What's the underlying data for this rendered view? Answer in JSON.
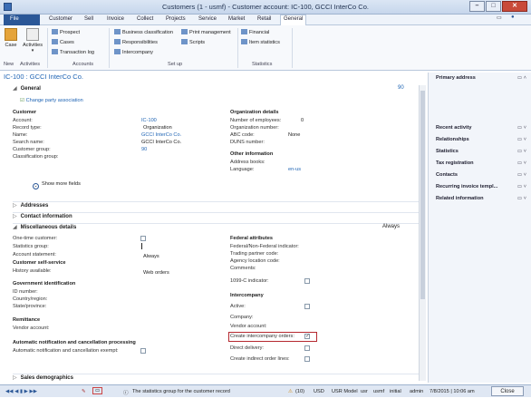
{
  "window": {
    "title": "Customers (1 - usmf) - Customer account: IC-100, GCCI InterCo Co."
  },
  "menu": {
    "file": "File",
    "tabs": [
      "Customer",
      "Sell",
      "Invoice",
      "Collect",
      "Projects",
      "Service",
      "Market",
      "Retail",
      "General"
    ]
  },
  "ribbon": {
    "new_case": "Case",
    "activities": "Activities",
    "new_group": "New",
    "activities_group": "Activities",
    "accounts_group": "Accounts",
    "setup_group": "Set up",
    "statistics_group": "Statistics",
    "prospect": "Prospect",
    "cases": "Cases",
    "transaction_log": "Transaction log",
    "business_classification": "Business classification",
    "responsibilities": "Responsibilities",
    "intercompany": "Intercompany",
    "print_management": "Print management",
    "scripts": "Scripts",
    "financial": "Financial",
    "item_statistics": "Item statistics"
  },
  "header": "IC-100 : GCCI InterCo Co.",
  "general": {
    "title": "General",
    "count": "90",
    "change_party": "Change party association",
    "customer_heading": "Customer",
    "account_label": "Account:",
    "account": "IC-100",
    "record_type_label": "Record type:",
    "record_type": "Organization",
    "name_label": "Name:",
    "name": "GCCI InterCo Co.",
    "search_name_label": "Search name:",
    "search_name": "GCCI InterCo Co.",
    "customer_group_label": "Customer group:",
    "customer_group": "90",
    "classification_label": "Classification group:",
    "org_heading": "Organization details",
    "employees_label": "Number of employees:",
    "employees": "0",
    "org_number_label": "Organization number:",
    "abc_label": "ABC code:",
    "abc": "None",
    "duns_label": "DUNS number:",
    "other_heading": "Other information",
    "address_books_label": "Address books:",
    "language_label": "Language:",
    "language": "en-us",
    "show_more": "Show more fields"
  },
  "sections": {
    "addresses": "Addresses",
    "contact": "Contact information",
    "misc": "Miscellaneous details",
    "misc_right": "Always",
    "sales": "Sales demographics"
  },
  "misc": {
    "one_time_label": "One-time customer:",
    "stat_group_label": "Statistics group:",
    "account_statement_label": "Account statement:",
    "account_statement": "Always",
    "self_service_heading": "Customer self-service",
    "history_label": "History available:",
    "history": "Web orders",
    "gov_heading": "Government identification",
    "id_number_label": "ID number:",
    "country_label": "Country/region:",
    "state_label": "State/province:",
    "remittance_heading": "Remittance",
    "vendor_account_label": "Vendor account:",
    "auto_heading": "Automatic notification and cancellation processing",
    "auto_exempt_label": "Automatic notification and cancellation exempt:",
    "federal_heading": "Federal attributes",
    "fed_indicator_label": "Federal/Non-Federal indicator:",
    "trading_partner_label": "Trading partner code:",
    "agency_label": "Agency location code:",
    "comments_label": "Comments:",
    "c1099_label": "1099-C indicator:",
    "ic_heading": "Intercompany",
    "active_label": "Active:",
    "company_label": "Company:",
    "ic_vendor_label": "Vendor account:",
    "create_ic_label": "Create intercompany orders:",
    "direct_delivery_label": "Direct delivery:",
    "indirect_label": "Create indirect order lines:"
  },
  "factbox": {
    "primary_address": "Primary address",
    "items": [
      "Recent activity",
      "Relationships",
      "Statistics",
      "Tax registration",
      "Contacts",
      "Recurring invoice templ...",
      "Related information"
    ]
  },
  "status": {
    "message": "The statistics group for the customer record",
    "count": "(10)",
    "currency": "USD",
    "model": "USR Model",
    "user": "usr",
    "company": "usmf",
    "layer": "initial",
    "admin": "admin",
    "datetime": "7/8/2015 | 10:06 am",
    "close": "Close"
  }
}
